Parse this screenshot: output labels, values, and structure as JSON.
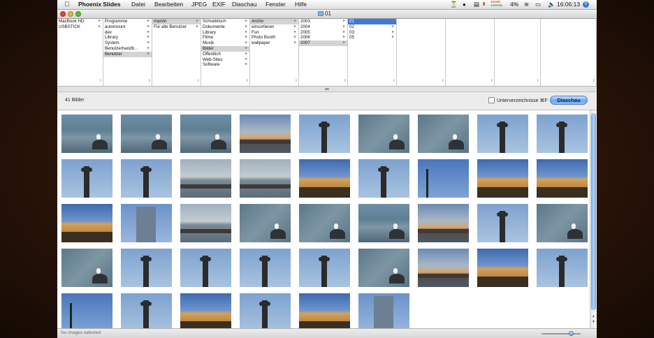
{
  "menubar": {
    "app_name": "Phoenix Slides",
    "items": [
      "Datei",
      "Bearbeiten",
      "JPEG",
      "EXIF",
      "Diaschau",
      "Fenster",
      "Hilfe"
    ],
    "mem_top": "452MB",
    "mem_bottom": "1596MB",
    "battery": "4%",
    "clock": "16:06:13"
  },
  "window": {
    "title": "01"
  },
  "browser": {
    "columns": [
      {
        "items": [
          "MacBook HD",
          "USBSTICK"
        ],
        "arrows": [
          true,
          true
        ],
        "selected": -1
      },
      {
        "items": [
          "Programme",
          "automount",
          "dev",
          "Library",
          "System",
          "Benutzerhandb...",
          "Benutzer"
        ],
        "arrows": [
          true,
          true,
          true,
          true,
          true,
          true,
          true
        ],
        "selected": 6
      },
      {
        "items": [
          "marvin",
          "Für alle Benutzer"
        ],
        "arrows": [
          true,
          true
        ],
        "selected": 0
      },
      {
        "items": [
          "Schreibtisch",
          "Dokumente",
          "Library",
          "Filme",
          "Musik",
          "Bilder",
          "Öffentlich",
          "Web-Sites",
          "Software"
        ],
        "arrows": [
          true,
          true,
          true,
          true,
          true,
          true,
          true,
          true,
          true
        ],
        "selected": 5
      },
      {
        "items": [
          "Archiv",
          "einsortieren",
          "Fun",
          "Photo Booth",
          "wallpaper"
        ],
        "arrows": [
          true,
          true,
          true,
          true,
          true
        ],
        "selected": 0
      },
      {
        "items": [
          "2003",
          "2004",
          "2005",
          "2006",
          "2007"
        ],
        "arrows": [
          true,
          true,
          true,
          true,
          true
        ],
        "selected": 4
      },
      {
        "items": [
          "01",
          "02",
          "03",
          "05"
        ],
        "arrows": [
          true,
          true,
          true,
          true
        ],
        "selected": 0,
        "selected_style": "blue"
      },
      {
        "items": [],
        "arrows": [],
        "selected": -1
      },
      {
        "items": [],
        "arrows": [],
        "selected": -1
      },
      {
        "items": [],
        "arrows": [],
        "selected": -1
      },
      {
        "items": [],
        "arrows": [],
        "selected": -1
      }
    ]
  },
  "toolbar": {
    "count_label": "41 Bilder",
    "subdir_label": "Unterverzeichnisse ⌘F",
    "subdir_checked": false,
    "slideshow_button": "Diaschau"
  },
  "thumbnails": [
    [
      "sky-sea",
      "sky-sea",
      "sky-sea",
      "sunset",
      "tower",
      "sea",
      "sea",
      "tower",
      "tower"
    ],
    [
      "tower",
      "tower",
      "harbor",
      "harbor",
      "building",
      "tower",
      "palm",
      "building",
      "building"
    ],
    [
      "building",
      "skyscr",
      "harbor",
      "sea",
      "sea",
      "sky-sea",
      "sunset",
      "tower",
      "sea"
    ],
    [
      "sea",
      "tower",
      "tower",
      "tower",
      "tower",
      "sea",
      "sunset",
      "building",
      "tower"
    ],
    [
      "palm",
      "tower",
      "building",
      "tower",
      "building",
      "skyscr"
    ]
  ],
  "status": {
    "text": "No images selected",
    "zoom_level": 0.8
  },
  "icons": {
    "apple": "apple-icon",
    "folder": "folder-icon",
    "spotlight": "spotlight-icon",
    "wifi": "wifi-icon",
    "battery": "battery-icon"
  }
}
